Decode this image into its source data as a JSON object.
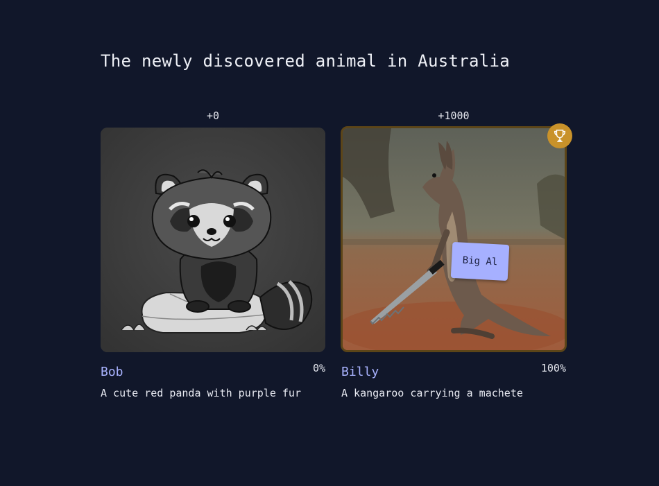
{
  "page": {
    "title": "The newly discovered animal in Australia"
  },
  "entries": [
    {
      "score": "+0",
      "creator": "Bob",
      "percent": "0%",
      "description": "A cute red panda with purple fur",
      "image": "red-panda-cartoon-grayscale",
      "winner": false
    },
    {
      "score": "+1000",
      "creator": "Billy",
      "percent": "100%",
      "description": "A kangaroo carrying a machete",
      "image": "kangaroo-with-machete-photo",
      "winner": true,
      "tag_label": "Big Al",
      "badge_icon": "trophy-icon"
    }
  ],
  "colors": {
    "background": "#11172a",
    "creator_name": "#a9b3ff",
    "winner_border": "#5c4518",
    "trophy_badge": "#c9922a",
    "tag_background": "#a6b0ff"
  }
}
